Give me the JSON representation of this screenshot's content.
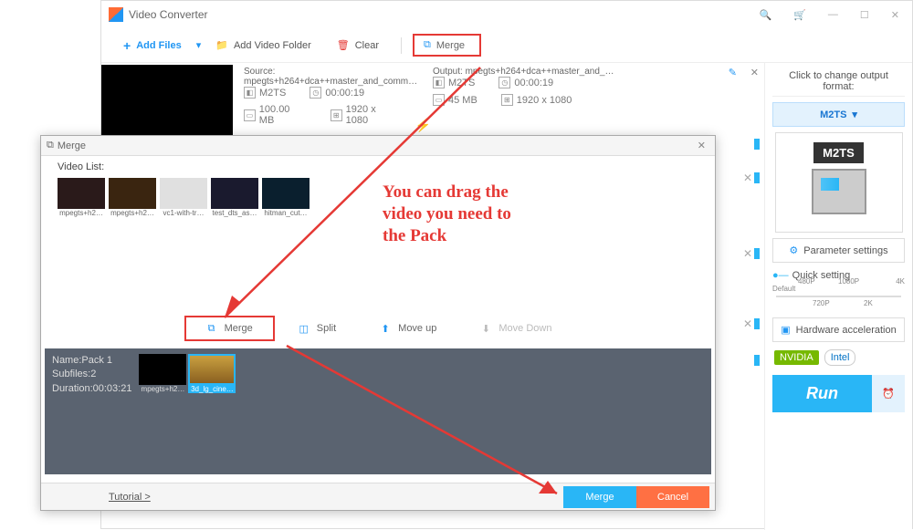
{
  "window": {
    "title": "Video Converter"
  },
  "toolbar": {
    "add_files": "Add Files",
    "add_folder": "Add Video Folder",
    "clear": "Clear",
    "merge": "Merge"
  },
  "source": {
    "label": "Source: mpegts+h264+dca++master_and_comm…",
    "container": "M2TS",
    "duration": "00:00:19",
    "size": "100.00 MB",
    "resolution": "1920 x 1080"
  },
  "output": {
    "label": "Output: mpegts+h264+dca++master_and_…",
    "container": "M2TS",
    "duration": "00:00:19",
    "size": "45 MB",
    "resolution": "1920 x 1080"
  },
  "sidebar": {
    "change_format": "Click to change output format:",
    "format": "M2TS",
    "format_badge": "M2TS",
    "param_settings": "Parameter settings",
    "quick_setting_label": "Quick setting",
    "ticks": {
      "p480": "480P",
      "p720": "720P",
      "p1080": "1080P",
      "p2k": "2K",
      "p4k": "4K",
      "default": "Default"
    },
    "hw_accel": "Hardware acceleration",
    "nvidia": "NVIDIA",
    "intel": "Intel",
    "run": "Run"
  },
  "merge_dialog": {
    "title": "Merge",
    "video_list_label": "Video List:",
    "thumbs": [
      "mpegts+h2…",
      "mpegts+h2…",
      "vc1-with-tr…",
      "test_dts_as…",
      "hitman_cut…"
    ],
    "instruction": "You can drag the video you need to the Pack",
    "actions": {
      "merge": "Merge",
      "split": "Split",
      "move_up": "Move up",
      "move_down": "Move Down"
    },
    "pack": {
      "name": "Name:Pack 1",
      "subfiles": "Subfiles:2",
      "duration": "Duration:00:03:21"
    },
    "pack_thumbs": [
      "mpegts+h2…",
      "3d_lg_cine…"
    ],
    "tutorial": "Tutorial >",
    "merge_btn": "Merge",
    "cancel_btn": "Cancel"
  }
}
